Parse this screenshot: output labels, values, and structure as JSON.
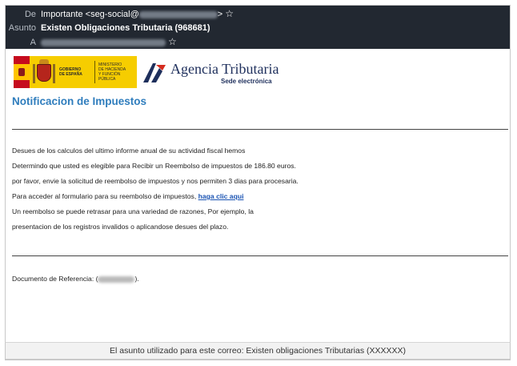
{
  "email_header": {
    "from_label": "De",
    "from_value": "Importante <seg-social@",
    "from_close": ">",
    "subject_label": "Asunto",
    "subject_value": "Existen Obligaciones Tributaria (968681)",
    "to_label": "A"
  },
  "logos": {
    "gobierno": "GOBIERNO\nDE ESPAÑA",
    "ministerio": "MINISTERIO\nDE HACIENDA\nY FUNCIÓN PÚBLICA",
    "agencia_name": "Agencia Tributaria",
    "agencia_sub": "Sede electrónica"
  },
  "email_body": {
    "title": "Notificacion de Impuestos",
    "line1": "Desues de los calculos del ultimo informe anual de su actividad fiscal hemos",
    "line2": "Determindo que usted es elegible para Recibir un Reembolso de impuestos de 186.80 euros.",
    "line3": "por favor, envie la solicitud de reembolso de impuestos y nos permiten 3 dias para procesaria.",
    "line4_text": "Para acceder al formulario para su reembolso de impuestos, ",
    "line4_link": "haga clic aqui",
    "line5": "Un reembolso se puede retrasar para una variedad de razones, Por ejemplo, la",
    "line6": "presentacion de los registros invalidos o aplicandose desues del plazo.",
    "reference_label": "Documento de Referencia: (",
    "reference_close": ")."
  },
  "caption": "El asunto utilizado para este correo: Existen obligaciones Tributarias (XXXXXX)",
  "colors": {
    "header_bg": "#222831",
    "title": "#2f7dbd",
    "link": "#1b54b3",
    "gob_yellow": "#f6cd00"
  },
  "icons": {
    "from_star": "star-outline-icon",
    "to_star": "star-outline-icon"
  }
}
